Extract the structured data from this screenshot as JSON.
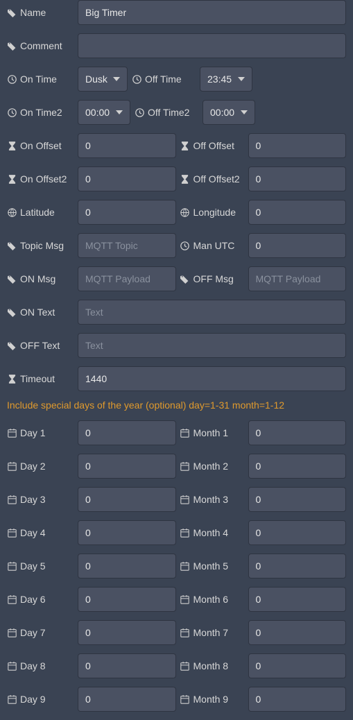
{
  "fields": {
    "name": {
      "label": "Name",
      "value": "Big Timer"
    },
    "comment": {
      "label": "Comment",
      "value": ""
    },
    "onTime": {
      "label": "On Time",
      "value": "Dusk"
    },
    "offTime": {
      "label": "Off Time",
      "value": "23:45"
    },
    "onTime2": {
      "label": "On Time2",
      "value": "00:00"
    },
    "offTime2": {
      "label": "Off Time2",
      "value": "00:00"
    },
    "onOffset": {
      "label": "On Offset",
      "value": "0"
    },
    "offOffset": {
      "label": "Off Offset",
      "value": "0"
    },
    "onOffset2": {
      "label": "On Offset2",
      "value": "0"
    },
    "offOffset2": {
      "label": "Off Offset2",
      "value": "0"
    },
    "latitude": {
      "label": "Latitude",
      "value": "0"
    },
    "longitude": {
      "label": "Longitude",
      "value": "0"
    },
    "topicMsg": {
      "label": "Topic Msg",
      "value": "",
      "placeholder": "MQTT Topic"
    },
    "manUtc": {
      "label": "Man UTC",
      "value": "0"
    },
    "onMsg": {
      "label": "ON Msg",
      "value": "",
      "placeholder": "MQTT Payload"
    },
    "offMsg": {
      "label": "OFF Msg",
      "value": "",
      "placeholder": "MQTT Payload"
    },
    "onText": {
      "label": "ON Text",
      "value": "",
      "placeholder": "Text"
    },
    "offText": {
      "label": "OFF Text",
      "value": "",
      "placeholder": "Text"
    },
    "timeout": {
      "label": "Timeout",
      "value": "1440"
    }
  },
  "specialNote": "Include special days of the year (optional) day=1-31 month=1-12",
  "days": [
    {
      "dayLabel": "Day 1",
      "dayValue": "0",
      "monthLabel": "Month 1",
      "monthValue": "0"
    },
    {
      "dayLabel": "Day 2",
      "dayValue": "0",
      "monthLabel": "Month 2",
      "monthValue": "0"
    },
    {
      "dayLabel": "Day 3",
      "dayValue": "0",
      "monthLabel": "Month 3",
      "monthValue": "0"
    },
    {
      "dayLabel": "Day 4",
      "dayValue": "0",
      "monthLabel": "Month 4",
      "monthValue": "0"
    },
    {
      "dayLabel": "Day 5",
      "dayValue": "0",
      "monthLabel": "Month 5",
      "monthValue": "0"
    },
    {
      "dayLabel": "Day 6",
      "dayValue": "0",
      "monthLabel": "Month 6",
      "monthValue": "0"
    },
    {
      "dayLabel": "Day 7",
      "dayValue": "0",
      "monthLabel": "Month 7",
      "monthValue": "0"
    },
    {
      "dayLabel": "Day 8",
      "dayValue": "0",
      "monthLabel": "Month 8",
      "monthValue": "0"
    },
    {
      "dayLabel": "Day 9",
      "dayValue": "0",
      "monthLabel": "Month 9",
      "monthValue": "0"
    }
  ]
}
